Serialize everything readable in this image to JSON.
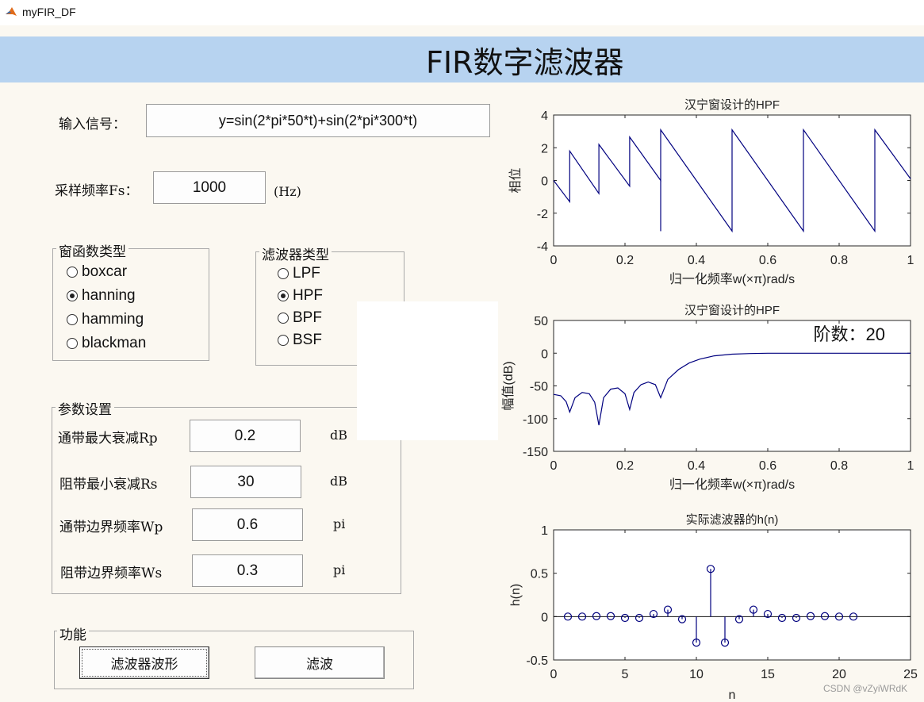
{
  "window": {
    "title": "myFIR_DF"
  },
  "banner": {
    "title": "FIR数字滤波器"
  },
  "input_signal": {
    "label": "输入信号：",
    "value": "y=sin(2*pi*50*t)+sin(2*pi*300*t)"
  },
  "sampling": {
    "label": "采样频率Fs：",
    "value": "1000",
    "unit": "(Hz)"
  },
  "window_type": {
    "title": "窗函数类型",
    "options": [
      {
        "label": "boxcar",
        "selected": false
      },
      {
        "label": "hanning",
        "selected": true
      },
      {
        "label": "hamming",
        "selected": false
      },
      {
        "label": "blackman",
        "selected": false
      }
    ]
  },
  "filter_type": {
    "title": "滤波器类型",
    "options": [
      {
        "label": "LPF",
        "selected": false
      },
      {
        "label": "HPF",
        "selected": true
      },
      {
        "label": "BPF",
        "selected": false
      },
      {
        "label": "BSF",
        "selected": false
      }
    ]
  },
  "params": {
    "title": "参数设置",
    "rows": [
      {
        "label": "通带最大衰减Rp",
        "value": "0.2",
        "unit": "dB"
      },
      {
        "label": "阻带最小衰减Rs",
        "value": "30",
        "unit": "dB"
      },
      {
        "label": "通带边界频率Wp",
        "value": "0.6",
        "unit": "pi"
      },
      {
        "label": "阻带边界频率Ws",
        "value": "0.3",
        "unit": "pi"
      }
    ]
  },
  "functions": {
    "title": "功能",
    "waveform_button": "滤波器波形",
    "filter_button": "滤波"
  },
  "watermark": "CSDN @vZyiWRdK",
  "chart_data": [
    {
      "type": "line",
      "title": "汉宁窗设计的HPF",
      "xlabel": "归一化频率w(×π)rad/s",
      "ylabel": "相位",
      "xlim": [
        0,
        1
      ],
      "ylim": [
        -4,
        4
      ],
      "xticks": [
        "0",
        "0.2",
        "0.4",
        "0.6",
        "0.8",
        "1"
      ],
      "yticks": [
        "4",
        "2",
        "0",
        "-2",
        "-4"
      ],
      "color": "#00007f",
      "x": [
        0,
        0.045,
        0.045,
        0.127,
        0.127,
        0.213,
        0.213,
        0.3,
        0.3,
        0.5,
        0.5,
        0.7,
        0.7,
        0.9,
        0.9,
        1.0
      ],
      "y": [
        0,
        -1.3,
        1.8,
        -0.8,
        2.2,
        -0.35,
        2.65,
        0.0,
        3.1,
        -3.1,
        3.1,
        -3.1,
        3.1,
        -3.1,
        3.1,
        0.1
      ],
      "extra_segments": [
        {
          "x": [
            0.3,
            0.3
          ],
          "y": [
            0.0,
            -3.1
          ]
        }
      ]
    },
    {
      "type": "line",
      "title": "汉宁窗设计的HPF",
      "xlabel": "归一化频率w(×π)rad/s",
      "ylabel": "幅值(dB)",
      "annotation": "阶数：20",
      "xlim": [
        0,
        1
      ],
      "ylim": [
        -150,
        50
      ],
      "xticks": [
        "0",
        "0.2",
        "0.4",
        "0.6",
        "0.8",
        "1"
      ],
      "yticks": [
        "50",
        "0",
        "-50",
        "-100",
        "-150"
      ],
      "color": "#00007f",
      "x": [
        0,
        0.02,
        0.035,
        0.045,
        0.06,
        0.08,
        0.1,
        0.115,
        0.127,
        0.14,
        0.16,
        0.18,
        0.2,
        0.213,
        0.225,
        0.245,
        0.265,
        0.285,
        0.3,
        0.32,
        0.35,
        0.38,
        0.41,
        0.45,
        0.5,
        0.55,
        0.6,
        0.7,
        0.8,
        0.9,
        1.0
      ],
      "y": [
        -63,
        -65,
        -74,
        -90,
        -68,
        -60,
        -62,
        -75,
        -110,
        -68,
        -55,
        -53,
        -62,
        -86,
        -60,
        -48,
        -44,
        -48,
        -68,
        -40,
        -25,
        -15,
        -9,
        -4,
        -1.5,
        -0.5,
        0,
        0,
        0,
        0,
        0
      ]
    },
    {
      "type": "stem",
      "title": "实际滤波器的h(n)",
      "xlabel": "n",
      "ylabel": "h(n)",
      "xlim": [
        0,
        25
      ],
      "ylim": [
        -0.5,
        1
      ],
      "xticks": [
        "0",
        "5",
        "10",
        "15",
        "20",
        "25"
      ],
      "yticks": [
        "1",
        "0.5",
        "0",
        "-0.5"
      ],
      "color": "#00007f",
      "x": [
        1,
        2,
        3,
        4,
        5,
        6,
        7,
        8,
        9,
        10,
        11,
        12,
        13,
        14,
        15,
        16,
        17,
        18,
        19,
        20,
        21
      ],
      "y": [
        0.0,
        0.0,
        0.005,
        0.005,
        -0.015,
        -0.015,
        0.03,
        0.08,
        -0.03,
        -0.3,
        0.55,
        -0.3,
        -0.03,
        0.08,
        0.03,
        -0.015,
        -0.015,
        0.005,
        0.005,
        0.0,
        0.0
      ]
    }
  ]
}
